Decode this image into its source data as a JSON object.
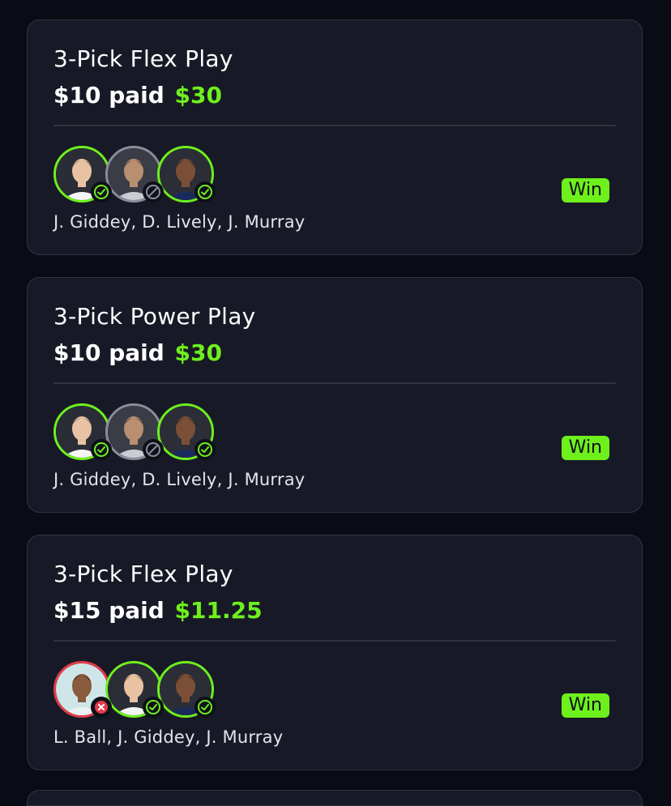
{
  "cards": [
    {
      "title": "3-Pick Flex Play",
      "paid": "$10 paid",
      "payout": "$30",
      "names": "J. Giddey, D. Lively, J. Murray",
      "result": "Win",
      "picks": [
        {
          "status": "hit",
          "player": "giddey"
        },
        {
          "status": "void",
          "player": "lively"
        },
        {
          "status": "hit",
          "player": "murray"
        }
      ]
    },
    {
      "title": "3-Pick Power Play",
      "paid": "$10 paid",
      "payout": "$30",
      "names": "J. Giddey, D. Lively, J. Murray",
      "result": "Win",
      "picks": [
        {
          "status": "hit",
          "player": "giddey"
        },
        {
          "status": "void",
          "player": "lively"
        },
        {
          "status": "hit",
          "player": "murray"
        }
      ]
    },
    {
      "title": "3-Pick Flex Play",
      "paid": "$15 paid",
      "payout": "$11.25",
      "names": "L. Ball, J. Giddey, J. Murray",
      "result": "Win",
      "picks": [
        {
          "status": "miss",
          "player": "ball"
        },
        {
          "status": "hit",
          "player": "giddey"
        },
        {
          "status": "hit",
          "player": "murray"
        }
      ]
    }
  ],
  "colors": {
    "accent": "#6ef01d",
    "miss": "#e23b4a",
    "void": "#8a8e98",
    "card_bg": "#171a26",
    "page_bg": "#0a0c15"
  }
}
